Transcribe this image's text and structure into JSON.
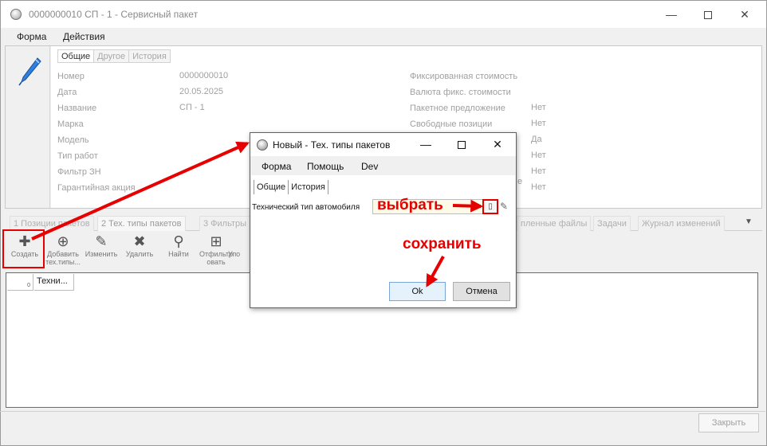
{
  "window": {
    "title": "0000000010 СП - 1 - Сервисный пакет",
    "minimize_label": "—",
    "close_label": "✕"
  },
  "menu": {
    "items": [
      "Форма",
      "Действия"
    ]
  },
  "form_tabs": [
    "Общие",
    "Другое",
    "История"
  ],
  "fields_left": [
    {
      "label": "Номер",
      "value": "0000000010"
    },
    {
      "label": "Дата",
      "value": "20.05.2025"
    },
    {
      "label": "Название",
      "value": "СП - 1"
    },
    {
      "label": "Марка",
      "value": ""
    },
    {
      "label": "Модель",
      "value": ""
    },
    {
      "label": "Тип работ",
      "value": ""
    },
    {
      "label": "Фильтр ЗН",
      "value": ""
    },
    {
      "label": "Гарантийная акция",
      "value": ""
    }
  ],
  "fields_right": [
    {
      "label": "Фиксированная стоимость",
      "value": ""
    },
    {
      "label": "Валюта фикс. стоимости",
      "value": ""
    },
    {
      "label": "Пакетное предложение",
      "value": "Нет"
    },
    {
      "label": "Свободные позиции",
      "value": "Нет"
    },
    {
      "label": "",
      "value": "Да"
    },
    {
      "label": "",
      "value": "Нет"
    },
    {
      "label": "",
      "value": "Нет"
    },
    {
      "label": "е",
      "value": "Нет"
    }
  ],
  "bottom_tabs": [
    {
      "label": "1 Позиции пакетов"
    },
    {
      "label": "2 Тех. типы пакетов"
    },
    {
      "label": "3 Фильтры"
    },
    {
      "label": "пленные файлы"
    },
    {
      "label": "Задачи"
    },
    {
      "label": "Журнал изменений"
    }
  ],
  "tabs_dropdown": "▼",
  "toolbar": [
    {
      "name": "create",
      "icon": "plus-icon",
      "glyph": "✚",
      "label": "Создать",
      "label2": ""
    },
    {
      "name": "add-tech-types",
      "icon": "add-list-icon",
      "glyph": "⊕",
      "label": "Добавить",
      "label2": "тех.типы..."
    },
    {
      "name": "edit",
      "icon": "pencil-icon",
      "glyph": "✎",
      "label": "Изменить",
      "label2": ""
    },
    {
      "name": "delete",
      "icon": "cross-icon",
      "glyph": "✖",
      "label": "Удалить",
      "label2": ""
    },
    {
      "name": "find",
      "icon": "binoculars-icon",
      "glyph": "⚲",
      "label": "Найти",
      "label2": ""
    },
    {
      "name": "filter",
      "icon": "filter-icon",
      "glyph": "⊞",
      "label": "Отфильтр",
      "label2": "овать"
    },
    {
      "name": "order",
      "icon": "sort-icon",
      "glyph": "",
      "label": "Упо",
      "label2": ""
    }
  ],
  "grid": {
    "row_header": "0",
    "columns": [
      "Техни..."
    ]
  },
  "close_button": "Закрыть",
  "dialog": {
    "title": "Новый - Тех. типы пакетов",
    "menu": [
      "Форма",
      "Помощь",
      "Dev"
    ],
    "tabs": [
      "Общие",
      "История"
    ],
    "field_label": "Технический тип автомобиля",
    "field_value": "",
    "pick_glyph": "▯",
    "edit_glyph": "✎",
    "ok_label": "Ok",
    "cancel_label": "Отмена",
    "minimize_label": "—",
    "close_label": "✕"
  },
  "annotations": {
    "pick_text": "выбрать",
    "save_text": "сохранить",
    "color": "#e60000"
  },
  "colors": {
    "annotation_red": "#e60000",
    "input_yellow": "#fdfbe8",
    "ok_blue": "#e5f1fb"
  }
}
